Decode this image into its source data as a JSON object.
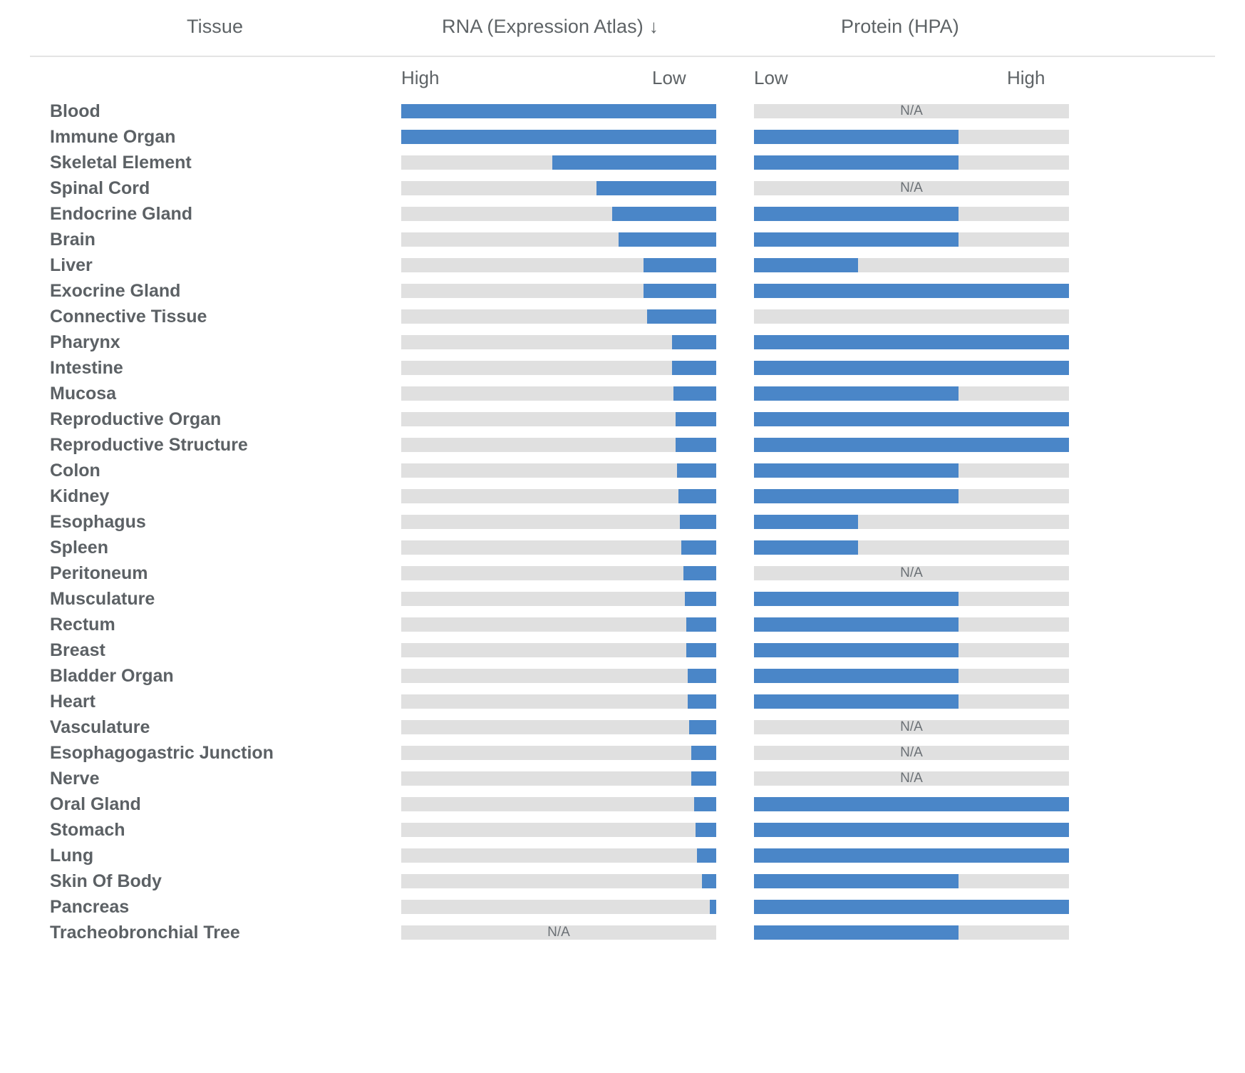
{
  "header": {
    "tissue_label": "Tissue",
    "rna_label": "RNA (Expression Atlas)",
    "rna_sort_icon": "arrow-down-icon",
    "rna_sort_glyph": "↓",
    "protein_label": "Protein (HPA)"
  },
  "scale": {
    "rna_left": "High",
    "rna_right": "Low",
    "protein_left": "Low",
    "protein_right": "High"
  },
  "na_text": "N/A",
  "colors": {
    "bar_fill": "#4a86c8",
    "bar_track": "#e0e0e0",
    "text": "#5c6165",
    "header_rule": "#e4e4e4"
  },
  "chart_data": {
    "type": "bar",
    "title": "Tissue expression: RNA (Expression Atlas) vs Protein (HPA)",
    "xlabel": "",
    "ylabel": "Tissue",
    "grid": false,
    "legend": null,
    "notes": "RNA bars are right-anchored on a High(left)→Low(right) axis; Protein bars are left-anchored on a Low(left)→High(right) axis. Values are percent of full track width. null = N/A.",
    "categories": [
      "Blood",
      "Immune Organ",
      "Skeletal Element",
      "Spinal Cord",
      "Endocrine Gland",
      "Brain",
      "Liver",
      "Exocrine Gland",
      "Connective Tissue",
      "Pharynx",
      "Intestine",
      "Mucosa",
      "Reproductive Organ",
      "Reproductive Structure",
      "Colon",
      "Kidney",
      "Esophagus",
      "Spleen",
      "Peritoneum",
      "Musculature",
      "Rectum",
      "Breast",
      "Bladder Organ",
      "Heart",
      "Vasculature",
      "Esophagogastric Junction",
      "Nerve",
      "Oral Gland",
      "Stomach",
      "Lung",
      "Skin Of Body",
      "Pancreas",
      "Tracheobronchial Tree"
    ],
    "series": [
      {
        "name": "RNA (Expression Atlas)",
        "anchor": "right",
        "values": [
          100,
          100,
          52,
          38,
          33,
          31,
          23,
          23,
          22,
          14,
          14,
          13.5,
          13,
          13,
          12.5,
          12,
          11.5,
          11,
          10.5,
          10,
          9.5,
          9.5,
          9,
          9,
          8.5,
          8,
          8,
          7,
          6.5,
          6,
          4.5,
          2,
          null
        ]
      },
      {
        "name": "Protein (HPA)",
        "anchor": "left",
        "values": [
          null,
          65,
          65,
          null,
          65,
          65,
          33,
          100,
          0,
          100,
          100,
          65,
          100,
          100,
          65,
          65,
          33,
          33,
          null,
          65,
          65,
          65,
          65,
          65,
          null,
          null,
          null,
          100,
          100,
          100,
          65,
          100,
          65
        ]
      }
    ]
  },
  "rows": [
    {
      "tissue": "Blood",
      "rna": 100,
      "protein": null
    },
    {
      "tissue": "Immune Organ",
      "rna": 100,
      "protein": 65
    },
    {
      "tissue": "Skeletal Element",
      "rna": 52,
      "protein": 65
    },
    {
      "tissue": "Spinal Cord",
      "rna": 38,
      "protein": null
    },
    {
      "tissue": "Endocrine Gland",
      "rna": 33,
      "protein": 65
    },
    {
      "tissue": "Brain",
      "rna": 31,
      "protein": 65
    },
    {
      "tissue": "Liver",
      "rna": 23,
      "protein": 33
    },
    {
      "tissue": "Exocrine Gland",
      "rna": 23,
      "protein": 100
    },
    {
      "tissue": "Connective Tissue",
      "rna": 22,
      "protein": 0
    },
    {
      "tissue": "Pharynx",
      "rna": 14,
      "protein": 100
    },
    {
      "tissue": "Intestine",
      "rna": 14,
      "protein": 100
    },
    {
      "tissue": "Mucosa",
      "rna": 13.5,
      "protein": 65
    },
    {
      "tissue": "Reproductive Organ",
      "rna": 13,
      "protein": 100
    },
    {
      "tissue": "Reproductive Structure",
      "rna": 13,
      "protein": 100
    },
    {
      "tissue": "Colon",
      "rna": 12.5,
      "protein": 65
    },
    {
      "tissue": "Kidney",
      "rna": 12,
      "protein": 65
    },
    {
      "tissue": "Esophagus",
      "rna": 11.5,
      "protein": 33
    },
    {
      "tissue": "Spleen",
      "rna": 11,
      "protein": 33
    },
    {
      "tissue": "Peritoneum",
      "rna": 10.5,
      "protein": null
    },
    {
      "tissue": "Musculature",
      "rna": 10,
      "protein": 65
    },
    {
      "tissue": "Rectum",
      "rna": 9.5,
      "protein": 65
    },
    {
      "tissue": "Breast",
      "rna": 9.5,
      "protein": 65
    },
    {
      "tissue": "Bladder Organ",
      "rna": 9,
      "protein": 65
    },
    {
      "tissue": "Heart",
      "rna": 9,
      "protein": 65
    },
    {
      "tissue": "Vasculature",
      "rna": 8.5,
      "protein": null
    },
    {
      "tissue": "Esophagogastric Junction",
      "rna": 8,
      "protein": null
    },
    {
      "tissue": "Nerve",
      "rna": 8,
      "protein": null
    },
    {
      "tissue": "Oral Gland",
      "rna": 7,
      "protein": 100
    },
    {
      "tissue": "Stomach",
      "rna": 6.5,
      "protein": 100
    },
    {
      "tissue": "Lung",
      "rna": 6,
      "protein": 100
    },
    {
      "tissue": "Skin Of Body",
      "rna": 4.5,
      "protein": 65
    },
    {
      "tissue": "Pancreas",
      "rna": 2,
      "protein": 100
    },
    {
      "tissue": "Tracheobronchial Tree",
      "rna": null,
      "protein": 65
    }
  ]
}
